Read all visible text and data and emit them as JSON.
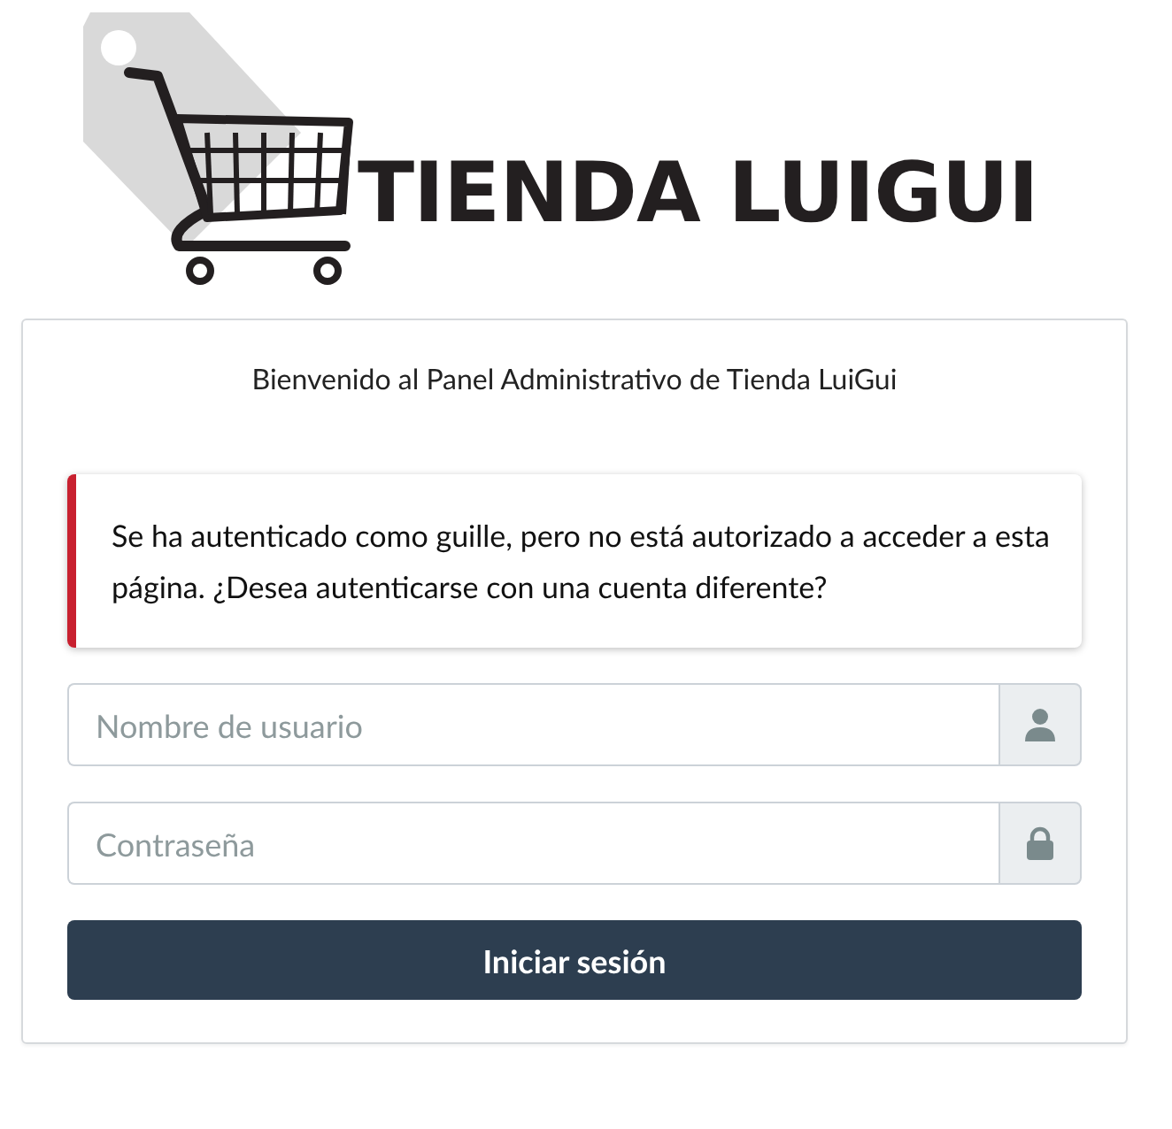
{
  "logo": {
    "text": "TIENDA LUIGUI"
  },
  "card": {
    "welcome": "Bienvenido al Panel Administrativo de Tienda LuiGui",
    "alert": "Se ha autenticado como guille, pero no está autorizado a acceder a esta página. ¿Desea autenticarse con una cuenta diferente?",
    "fields": [
      {
        "kind": "user",
        "placeholder": "Nombre de usuario"
      },
      {
        "kind": "password",
        "placeholder": "Contraseña"
      }
    ],
    "submit": "Iniciar sesión"
  }
}
